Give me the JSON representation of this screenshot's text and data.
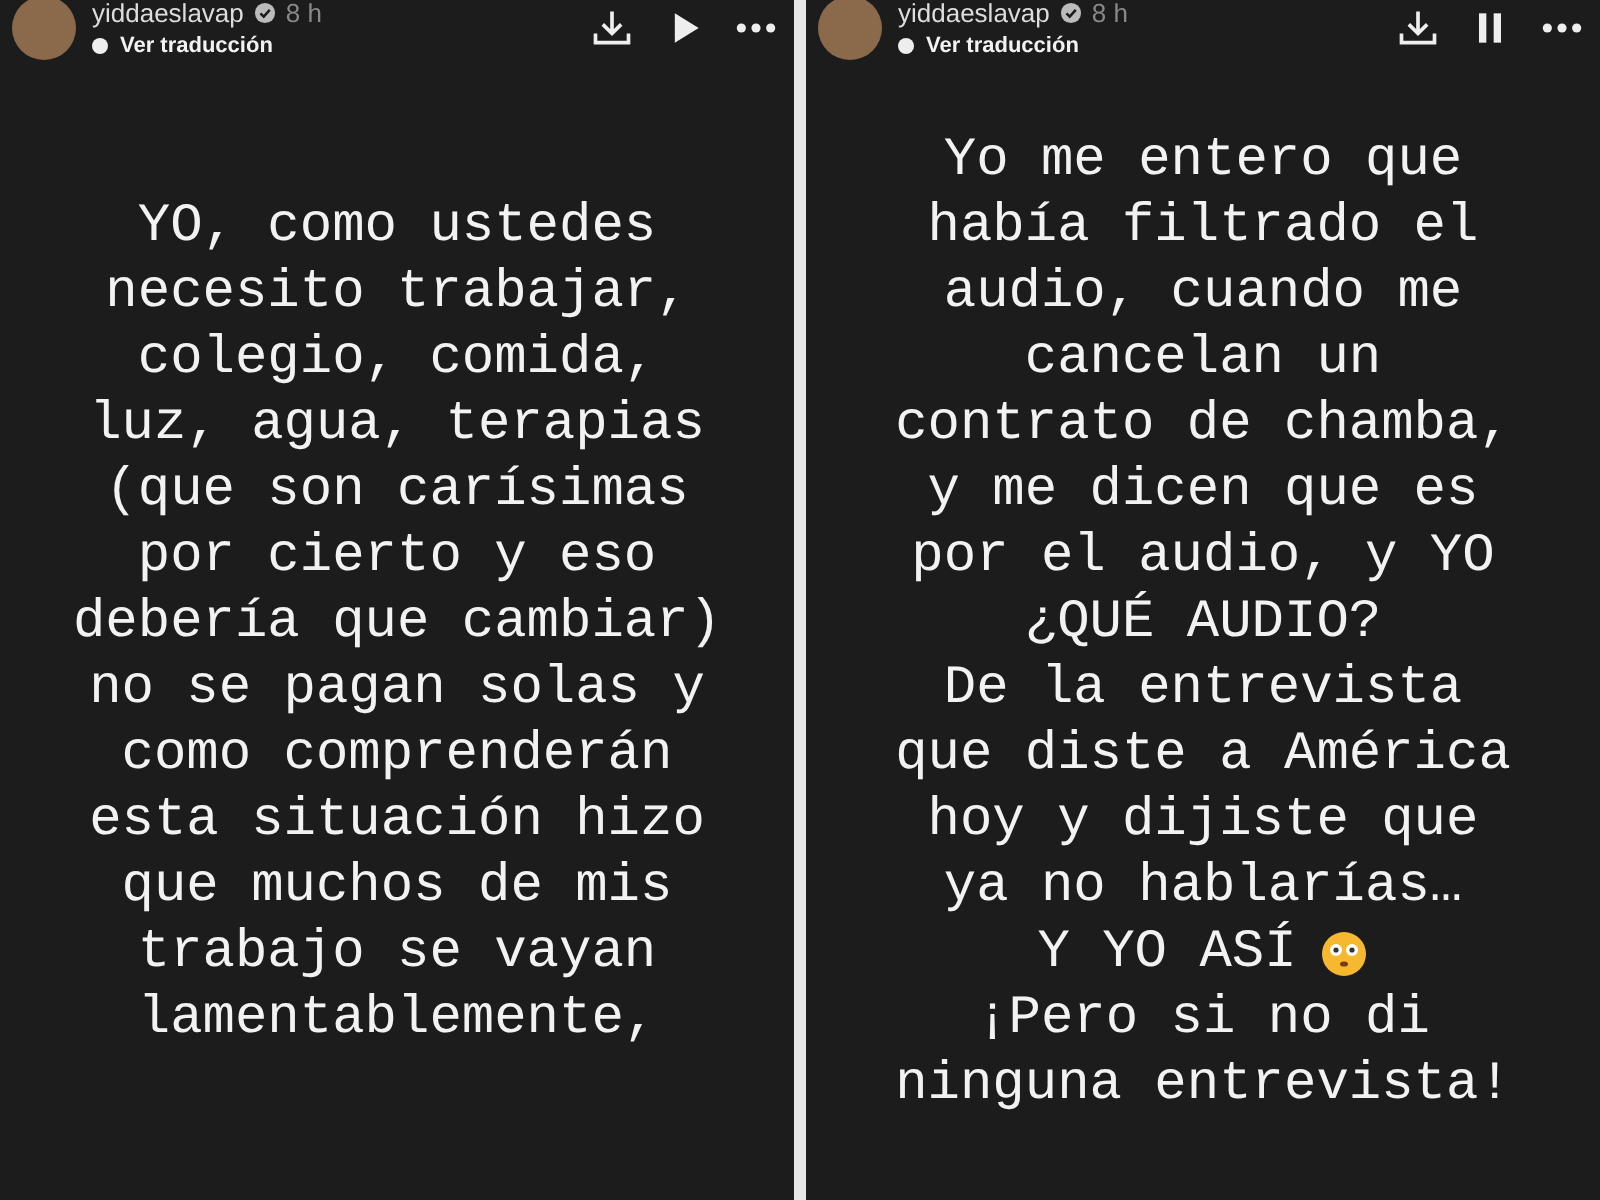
{
  "stories": [
    {
      "username": "yiddaeslavap",
      "time": "8 h",
      "translate": "Ver traducción",
      "paused": true,
      "lines": [
        {
          "text": "YO, como ustedes"
        },
        {
          "text": "necesito trabajar,"
        },
        {
          "text": "colegio, comida,"
        },
        {
          "text": "luz, agua, terapias"
        },
        {
          "text": "(que son carísimas"
        },
        {
          "text": "por cierto y eso"
        },
        {
          "text": "debería que cambiar)"
        },
        {
          "text": "no se pagan solas y"
        },
        {
          "text": "como comprenderán"
        },
        {
          "text": "esta situación hizo"
        },
        {
          "text": "que muchos de mis"
        },
        {
          "text": "trabajo se vayan"
        },
        {
          "text": "lamentablemente,"
        }
      ]
    },
    {
      "username": "yiddaeslavap",
      "time": "8 h",
      "translate": "Ver traducción",
      "paused": false,
      "lines": [
        {
          "text": "Yo me entero que"
        },
        {
          "text": "había filtrado el"
        },
        {
          "text": "audio, cuando me"
        },
        {
          "text": "cancelan un"
        },
        {
          "text": "contrato de chamba,"
        },
        {
          "text": "y me dicen que es"
        },
        {
          "text": "por el audio, y YO"
        },
        {
          "text": "¿QUÉ AUDIO?"
        },
        {
          "text": "De la entrevista"
        },
        {
          "text": "que diste a América"
        },
        {
          "text": "hoy y dijiste que"
        },
        {
          "text": "ya no hablarías…"
        },
        {
          "text": "Y YO ASÍ",
          "emoji": true
        },
        {
          "text": "¡Pero si no di"
        },
        {
          "text": "ninguna entrevista!"
        }
      ]
    }
  ]
}
